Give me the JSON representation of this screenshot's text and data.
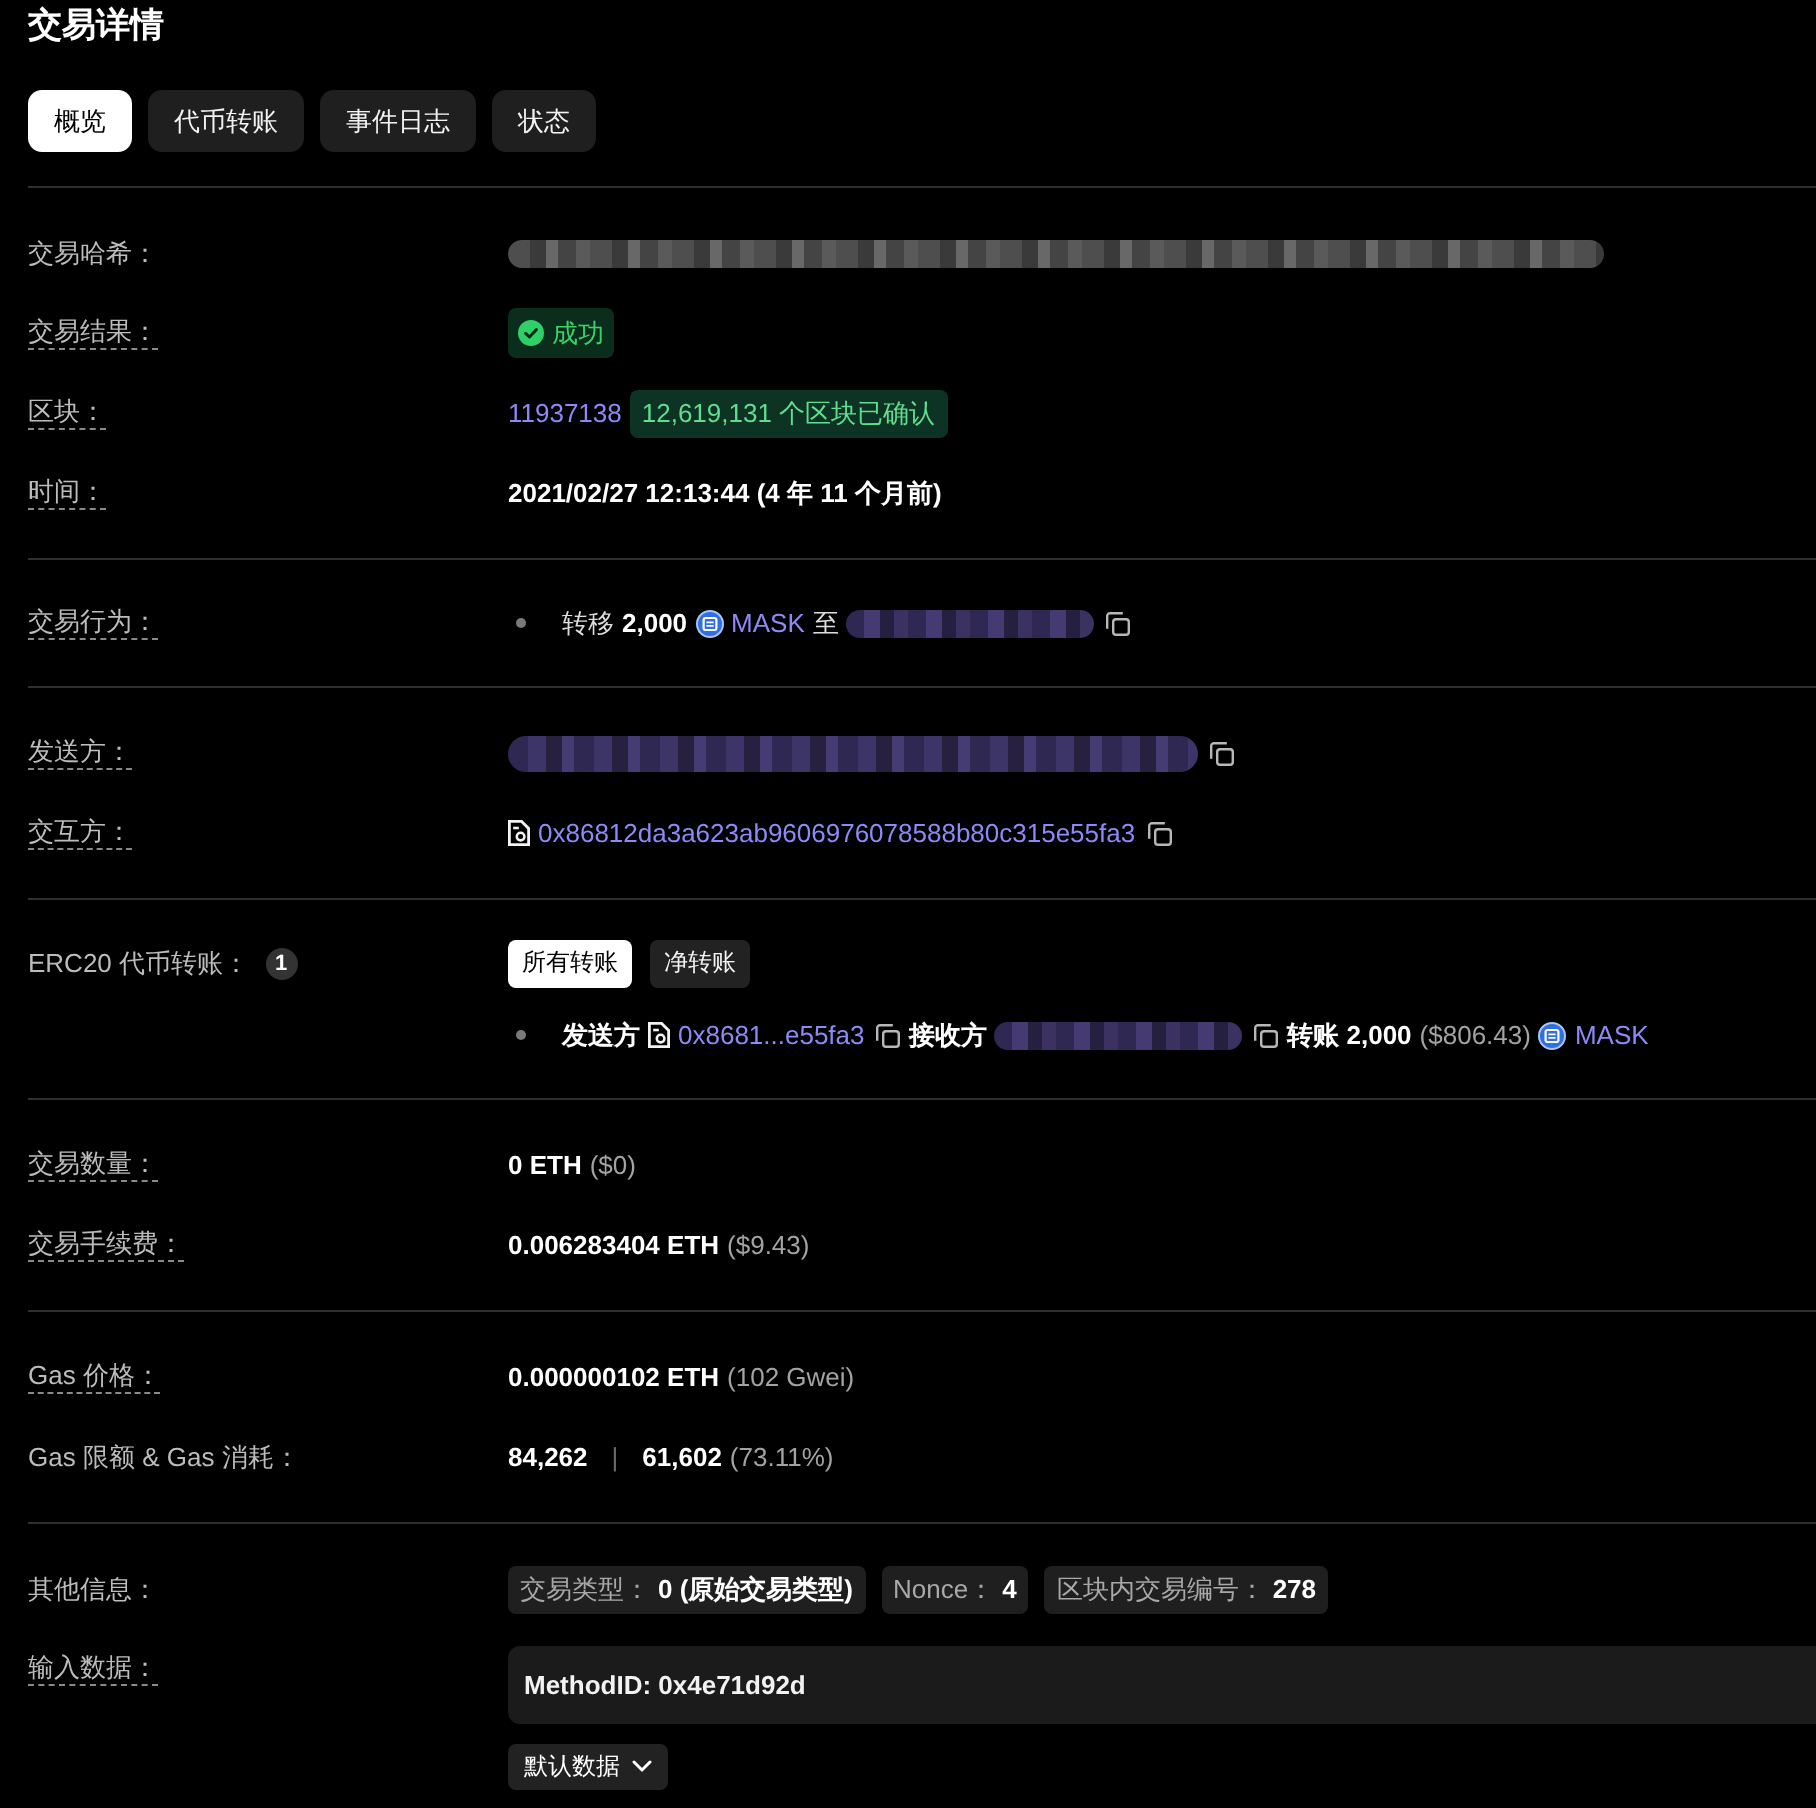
{
  "page": {
    "title": "交易详情"
  },
  "tabs": [
    {
      "label": "概览",
      "selected": true
    },
    {
      "label": "代币转账",
      "selected": false
    },
    {
      "label": "事件日志",
      "selected": false
    },
    {
      "label": "状态",
      "selected": false
    }
  ],
  "sections": [
    {
      "rows": [
        {
          "kind": "line",
          "label": "交易哈希：",
          "tooltip": false,
          "parts": [
            {
              "kind": "redacted-hash"
            }
          ]
        },
        {
          "kind": "line",
          "label": "交易结果：",
          "tooltip": true,
          "parts": [
            {
              "kind": "success",
              "text": "成功"
            }
          ]
        },
        {
          "kind": "line",
          "label": "区块：",
          "tooltip": true,
          "parts": [
            {
              "kind": "link",
              "text": "11937138"
            },
            {
              "kind": "confirm",
              "text": "12,619,131 个区块已确认"
            }
          ]
        },
        {
          "kind": "line",
          "label": "时间：",
          "tooltip": true,
          "parts": [
            {
              "kind": "strong",
              "text": "2021/02/27 12:13:44 (4 年 11 个月前)"
            }
          ]
        }
      ]
    },
    {
      "rows": [
        {
          "kind": "list",
          "label": "交易行为：",
          "tooltip": true,
          "items": [
            {
              "parts": [
                {
                  "kind": "plain",
                  "text": "转移"
                },
                {
                  "kind": "strong",
                  "text": "2,000"
                },
                {
                  "kind": "token",
                  "text": "MASK"
                },
                {
                  "kind": "plain",
                  "text": "至"
                },
                {
                  "kind": "redacted-short",
                  "copyable": true
                }
              ]
            }
          ]
        }
      ]
    },
    {
      "rows": [
        {
          "kind": "line",
          "label": "发送方：",
          "tooltip": true,
          "parts": [
            {
              "kind": "redacted-address",
              "copyable": true
            }
          ]
        },
        {
          "kind": "line",
          "label": "交互方：",
          "tooltip": true,
          "parts": [
            {
              "kind": "contract",
              "text": "0x86812da3a623ab9606976078588b80c315e55fa3",
              "copyable": true
            }
          ]
        }
      ]
    },
    {
      "rows": [
        {
          "kind": "list",
          "label": "ERC20 代币转账：",
          "tooltip": false,
          "count": "1",
          "filters": [
            {
              "label": "所有转账",
              "selected": true
            },
            {
              "label": "净转账",
              "selected": false
            }
          ],
          "items": [
            {
              "parts": [
                {
                  "kind": "strong",
                  "text": "发送方"
                },
                {
                  "kind": "contract",
                  "text": "0x8681...e55fa3",
                  "copyable": true
                },
                {
                  "kind": "strong",
                  "text": "接收方"
                },
                {
                  "kind": "redacted-short",
                  "copyable": true
                },
                {
                  "kind": "strong",
                  "text": "转账"
                },
                {
                  "kind": "strong",
                  "text": "2,000"
                },
                {
                  "kind": "muted",
                  "text": "($806.43)"
                },
                {
                  "kind": "token",
                  "text": "MASK"
                }
              ]
            }
          ]
        }
      ]
    },
    {
      "rows": [
        {
          "kind": "line",
          "label": "交易数量：",
          "tooltip": true,
          "parts": [
            {
              "kind": "strong",
              "text": "0 ETH"
            },
            {
              "kind": "muted",
              "text": "($0)"
            }
          ]
        },
        {
          "kind": "line",
          "label": "交易手续费：",
          "tooltip": true,
          "parts": [
            {
              "kind": "strong",
              "text": "0.006283404 ETH"
            },
            {
              "kind": "muted",
              "text": "($9.43)"
            }
          ]
        }
      ]
    },
    {
      "rows": [
        {
          "kind": "line",
          "label": "Gas 价格：",
          "tooltip": true,
          "parts": [
            {
              "kind": "strong",
              "text": "0.000000102 ETH"
            },
            {
              "kind": "muted",
              "text": "(102 Gwei)"
            }
          ]
        },
        {
          "kind": "line",
          "label": "Gas 限额 & Gas 消耗：",
          "tooltip": false,
          "parts": [
            {
              "kind": "strong",
              "text": "84,262"
            },
            {
              "kind": "divider",
              "text": "|"
            },
            {
              "kind": "strong",
              "text": "61,602"
            },
            {
              "kind": "muted",
              "text": "(73.11%)"
            }
          ]
        }
      ]
    },
    {
      "rows": [
        {
          "kind": "line",
          "label": "其他信息：",
          "tooltip": false,
          "parts": [
            {
              "kind": "chip",
              "label": "交易类型：",
              "value": "0 (原始交易类型)"
            },
            {
              "kind": "chip",
              "label": "Nonce：",
              "value": "4"
            },
            {
              "kind": "chip",
              "label": "区块内交易编号：",
              "value": "278"
            }
          ]
        },
        {
          "kind": "input",
          "label": "输入数据：",
          "tooltip": true,
          "value": "MethodID: 0x4e71d92d",
          "button": "默认数据"
        }
      ]
    }
  ]
}
